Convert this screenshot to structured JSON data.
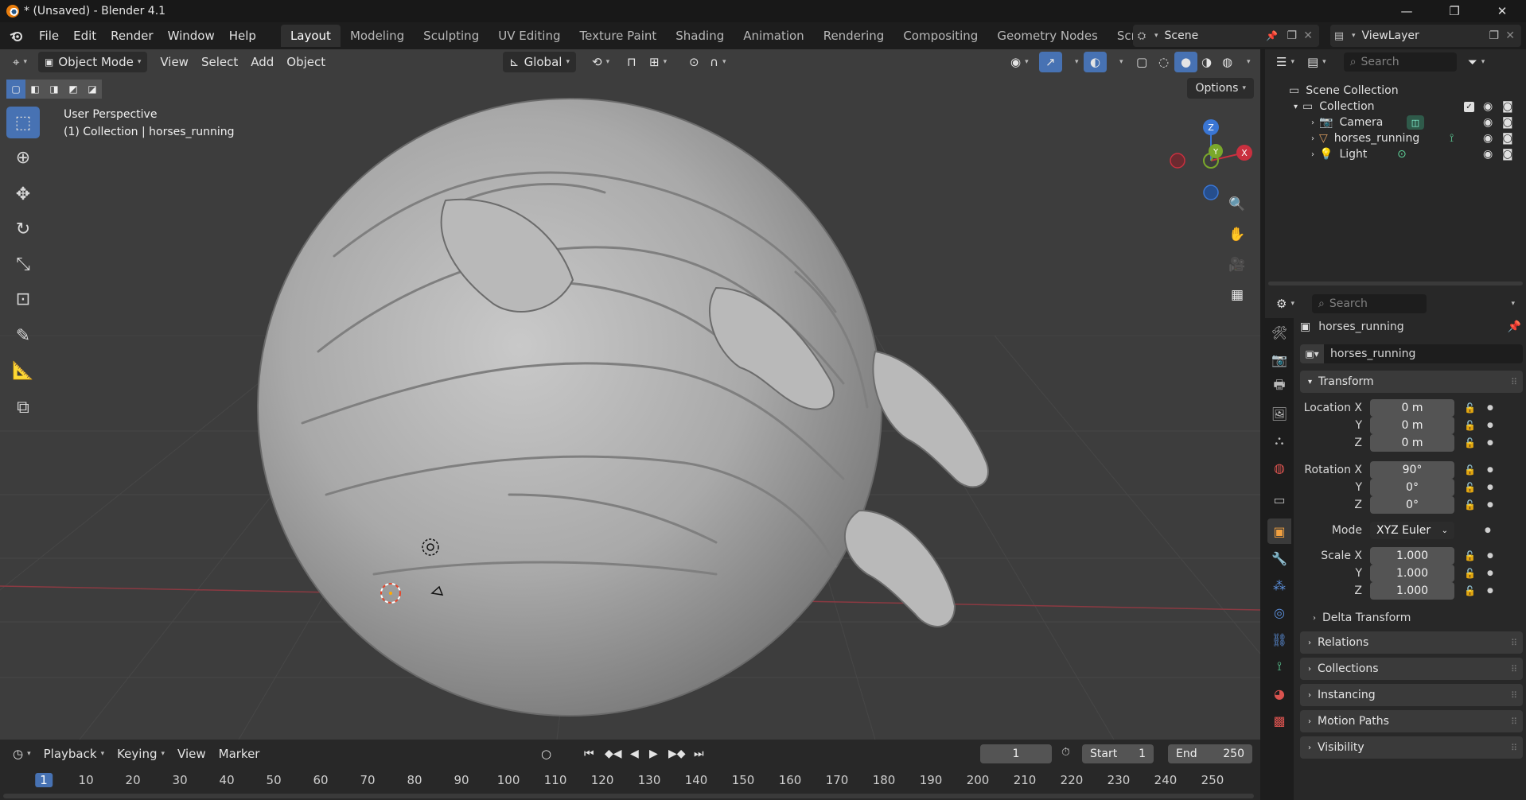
{
  "titlebar": {
    "title": "* (Unsaved) - Blender 4.1",
    "minimize": "—",
    "maximize": "❐",
    "close": "✕"
  },
  "menu": {
    "items": [
      "File",
      "Edit",
      "Render",
      "Window",
      "Help"
    ]
  },
  "workspaces": {
    "tabs": [
      "Layout",
      "Modeling",
      "Sculpting",
      "UV Editing",
      "Texture Paint",
      "Shading",
      "Animation",
      "Rendering",
      "Compositing",
      "Geometry Nodes",
      "Scripting"
    ],
    "active": "Layout",
    "add": "+"
  },
  "scene": {
    "label": "Scene"
  },
  "view_layer": {
    "label": "ViewLayer"
  },
  "viewport": {
    "mode": "Object Mode",
    "menus": [
      "View",
      "Select",
      "Add",
      "Object"
    ],
    "orientation": "Global",
    "options": "Options",
    "perspective": "User Perspective",
    "collection_info": "(1) Collection | horses_running",
    "gizmo": {
      "z": "Z",
      "x": "X",
      "y": "Y"
    }
  },
  "timeline": {
    "menus": [
      "Playback",
      "Keying",
      "View",
      "Marker"
    ],
    "current_frame": "1",
    "start_label": "Start",
    "start": "1",
    "end_label": "End",
    "end": "250",
    "ruler": [
      "1",
      "10",
      "20",
      "30",
      "40",
      "50",
      "60",
      "70",
      "80",
      "90",
      "100",
      "110",
      "120",
      "130",
      "140",
      "150",
      "160",
      "170",
      "180",
      "190",
      "200",
      "210",
      "220",
      "230",
      "240",
      "250"
    ]
  },
  "outliner": {
    "search_placeholder": "Search",
    "scene_collection": "Scene Collection",
    "collection": "Collection",
    "objects": [
      "Camera",
      "horses_running",
      "Light"
    ]
  },
  "properties": {
    "search_placeholder": "Search",
    "object_name": "horses_running",
    "object_field": "horses_running",
    "transform": {
      "header": "Transform",
      "location_label": "Location X",
      "location": [
        "0 m",
        "0 m",
        "0 m"
      ],
      "rotation_label": "Rotation X",
      "rotation": [
        "90°",
        "0°",
        "0°"
      ],
      "mode_label": "Mode",
      "mode": "XYZ Euler",
      "scale_label": "Scale X",
      "scale": [
        "1.000",
        "1.000",
        "1.000"
      ],
      "y_label": "Y",
      "z_label": "Z"
    },
    "sections": [
      "Delta Transform",
      "Relations",
      "Collections",
      "Instancing",
      "Motion Paths",
      "Visibility"
    ]
  },
  "colors": {
    "accent_blue": "#4772b3",
    "viewport_bg": "#3d3d3d",
    "panel_bg": "#282828",
    "axis_x": "#c9303f",
    "axis_y": "#7aa82b",
    "axis_z": "#3a76d4"
  }
}
